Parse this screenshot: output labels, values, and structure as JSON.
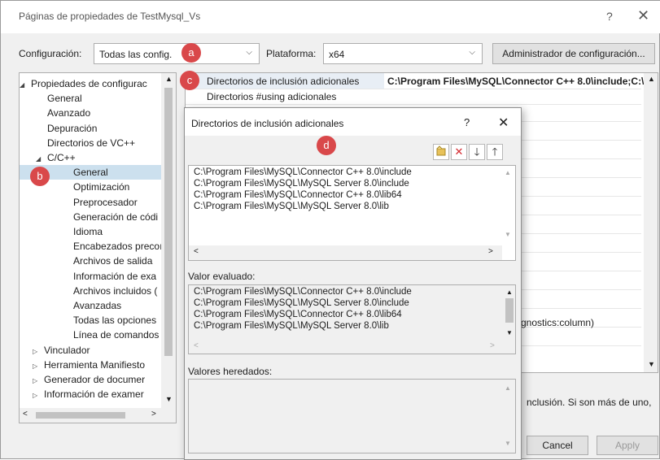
{
  "window": {
    "title": "Páginas de propiedades de TestMysql_Vs",
    "help": "?",
    "close": "✕"
  },
  "config_bar": {
    "config_label": "Configuración:",
    "config_value": "Todas las config.",
    "platform_label": "Plataforma:",
    "platform_value": "x64",
    "manager_button": "Administrador de configuración..."
  },
  "tree": {
    "items": [
      {
        "label": "Propiedades de configurac",
        "toggle": "◢"
      },
      {
        "label": "General"
      },
      {
        "label": "Avanzado"
      },
      {
        "label": "Depuración"
      },
      {
        "label": "Directorios de VC++"
      },
      {
        "label": "C/C++",
        "toggle": "◢"
      },
      {
        "label": "General",
        "selected": true
      },
      {
        "label": "Optimización"
      },
      {
        "label": "Preprocesador"
      },
      {
        "label": "Generación de códi"
      },
      {
        "label": "Idioma"
      },
      {
        "label": "Encabezados precoı"
      },
      {
        "label": "Archivos de salida"
      },
      {
        "label": "Información de exa"
      },
      {
        "label": "Archivos incluidos ("
      },
      {
        "label": "Avanzadas"
      },
      {
        "label": "Todas las opciones"
      },
      {
        "label": "Línea de comandos"
      },
      {
        "label": "Vinculador",
        "toggle": "▷"
      },
      {
        "label": "Herramienta Manifiesto",
        "toggle": "▷"
      },
      {
        "label": "Generador de documer",
        "toggle": "▷"
      },
      {
        "label": "Información de examer",
        "toggle": "▷"
      }
    ]
  },
  "grid": {
    "row1_name": "Directorios de inclusión adicionales",
    "row1_value": "C:\\Program Files\\MySQL\\Connector C++ 8.0\\include;C:\\I",
    "row2_name": "Directorios #using adicionales",
    "partial_value": "gnostics:column)",
    "description_partial": "nclusión. Si son más de uno,"
  },
  "footer": {
    "cancel": "Cancel",
    "apply": "Apply"
  },
  "dialog": {
    "title": "Directorios de inclusión adicionales",
    "help": "?",
    "close": "✕",
    "entries": [
      "C:\\Program Files\\MySQL\\Connector C++ 8.0\\include",
      "C:\\Program Files\\MySQL\\MySQL Server 8.0\\include",
      "C:\\Program Files\\MySQL\\Connector C++ 8.0\\lib64",
      "C:\\Program Files\\MySQL\\MySQL Server 8.0\\lib"
    ],
    "evaluated_label": "Valor evaluado:",
    "evaluated": [
      "C:\\Program Files\\MySQL\\Connector C++ 8.0\\include",
      "C:\\Program Files\\MySQL\\MySQL Server 8.0\\include",
      "C:\\Program Files\\MySQL\\Connector C++ 8.0\\lib64",
      "C:\\Program Files\\MySQL\\MySQL Server 8.0\\lib"
    ],
    "inherited_label": "Valores heredados:"
  },
  "badges": {
    "a": "a",
    "b": "b",
    "c": "c",
    "d": "d"
  },
  "colors": {
    "badge": "#d9484a",
    "selection": "#cce0ee",
    "delete": "#d4282e"
  }
}
